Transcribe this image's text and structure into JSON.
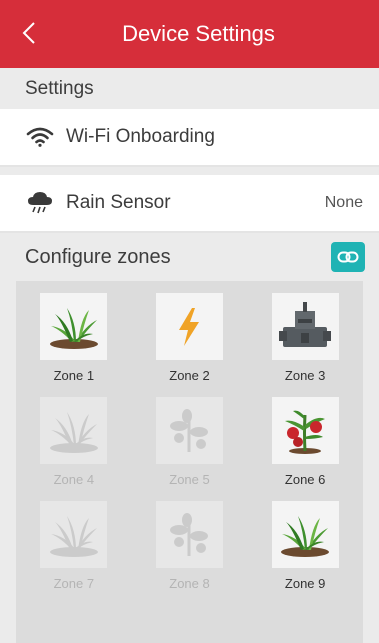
{
  "header": {
    "title": "Device Settings",
    "back_icon": "chevron-left-icon"
  },
  "settings": {
    "heading": "Settings",
    "wifi": {
      "label": "Wi-Fi Onboarding",
      "icon": "wifi-icon"
    },
    "rain": {
      "label": "Rain Sensor",
      "value": "None",
      "icon": "rain-cloud-icon"
    }
  },
  "zones": {
    "heading": "Configure zones",
    "link_icon": "link-icon",
    "items": [
      {
        "label": "Zone 1",
        "icon": "grass-icon",
        "enabled": true
      },
      {
        "label": "Zone 2",
        "icon": "lightning-icon",
        "enabled": true
      },
      {
        "label": "Zone 3",
        "icon": "valve-box-icon",
        "enabled": true
      },
      {
        "label": "Zone 4",
        "icon": "grass-icon",
        "enabled": false
      },
      {
        "label": "Zone 5",
        "icon": "plant-icon",
        "enabled": false
      },
      {
        "label": "Zone 6",
        "icon": "tomato-plant-icon",
        "enabled": true
      },
      {
        "label": "Zone 7",
        "icon": "grass-icon",
        "enabled": false
      },
      {
        "label": "Zone 8",
        "icon": "plant-icon",
        "enabled": false
      },
      {
        "label": "Zone 9",
        "icon": "grass-icon",
        "enabled": true
      }
    ]
  },
  "colors": {
    "header": "#d62e3a",
    "accent": "#1fb3b4",
    "background": "#ebebeb"
  }
}
